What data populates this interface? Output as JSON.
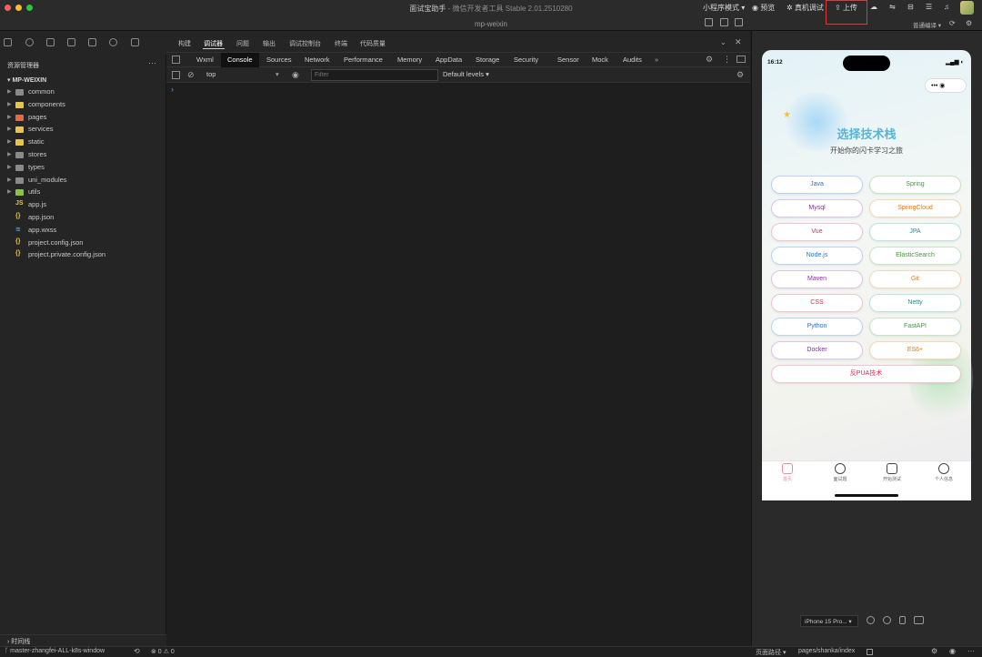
{
  "window": {
    "title": "面试宝助手",
    "title_suffix": " - 微信开发者工具 Stable 2.01.2510280",
    "project": "mp-weixin"
  },
  "toolbar": {
    "mode": "小程序模式 ▾",
    "preview": "预览",
    "real_debug": "真机调试",
    "upload": "上传",
    "compile_mode": "普通编译 ▾"
  },
  "sidebar": {
    "header": "资源管理器",
    "more": "···",
    "project_name": "MP-WEIXIN",
    "folders": [
      {
        "name": "common",
        "color": "#8a8a8a"
      },
      {
        "name": "components",
        "color": "#e8c44a"
      },
      {
        "name": "pages",
        "color": "#e06a4a"
      },
      {
        "name": "services",
        "color": "#e8c44a"
      },
      {
        "name": "static",
        "color": "#e8c44a"
      },
      {
        "name": "stores",
        "color": "#8a8a8a"
      },
      {
        "name": "types",
        "color": "#8a8a8a"
      },
      {
        "name": "uni_modules",
        "color": "#8a8a8a"
      },
      {
        "name": "utils",
        "color": "#8bc34a"
      }
    ],
    "files": [
      {
        "name": "app.js",
        "icon": "JS",
        "color": "#e8c44a"
      },
      {
        "name": "app.json",
        "icon": "{}",
        "color": "#e8c44a"
      },
      {
        "name": "app.wxss",
        "icon": "≋",
        "color": "#4a9de6"
      },
      {
        "name": "project.config.json",
        "icon": "{}",
        "color": "#e8c44a"
      },
      {
        "name": "project.private.config.json",
        "icon": "{}",
        "color": "#e8c44a"
      }
    ],
    "timeline": "时间线"
  },
  "devtools": {
    "top_tabs": [
      "构建",
      "调试器",
      "问题",
      "输出",
      "调试控制台",
      "终端",
      "代码质量"
    ],
    "chrome_tabs": [
      "Wxml",
      "Console",
      "Sources",
      "Network",
      "Performance",
      "Memory",
      "AppData",
      "Storage",
      "Security",
      "Sensor",
      "Mock",
      "Audits"
    ],
    "overflow": "»",
    "context": "top",
    "filter_placeholder": "Filter",
    "levels": "Default levels ▾",
    "prompt": "›"
  },
  "simulator": {
    "time": "16:12",
    "status_right": "▂▄▆ ◐",
    "capsule": "•••  ◉",
    "title": "选择技术栈",
    "subtitle": "开始你的闪卡学习之旅",
    "tech_buttons": [
      {
        "label": "Java",
        "color": "#2d6fd1",
        "border": "#b9d3f5"
      },
      {
        "label": "Spring",
        "color": "#3e9a3e",
        "border": "#c5e6c3"
      },
      {
        "label": "Mysql",
        "color": "#8a2ba8",
        "border": "#dcc5ea"
      },
      {
        "label": "SpringCloud",
        "color": "#e0791d",
        "border": "#f4d8b9"
      },
      {
        "label": "Vue",
        "color": "#d6304f",
        "border": "#f3c4cf"
      },
      {
        "label": "JPA",
        "color": "#2a8a8a",
        "border": "#bfe3e1"
      },
      {
        "label": "Node.js",
        "color": "#2d6fd1",
        "border": "#b9d3f5"
      },
      {
        "label": "ElasticSearch",
        "color": "#3e9a3e",
        "border": "#c5e6c3"
      },
      {
        "label": "Maven",
        "color": "#8a2ba8",
        "border": "#dcc5ea"
      },
      {
        "label": "Git",
        "color": "#e0791d",
        "border": "#f4d8b9"
      },
      {
        "label": "CSS",
        "color": "#d6304f",
        "border": "#f3c4cf"
      },
      {
        "label": "Netty",
        "color": "#2a8a8a",
        "border": "#bfe3e1"
      },
      {
        "label": "Python",
        "color": "#2d6fd1",
        "border": "#b9d3f5"
      },
      {
        "label": "FastAPI",
        "color": "#3e9a3e",
        "border": "#c5e6c3"
      },
      {
        "label": "Docker",
        "color": "#8a2ba8",
        "border": "#dcc5ea"
      },
      {
        "label": "ES6+",
        "color": "#e0791d",
        "border": "#f4d8b9"
      },
      {
        "label": "反PUA技术",
        "color": "#d6304f",
        "border": "#f3c4cf"
      }
    ],
    "tabbar": [
      {
        "label": "首页",
        "color": "#f08aa0"
      },
      {
        "label": "面试题",
        "color": "#666"
      },
      {
        "label": "开始测试",
        "color": "#666"
      },
      {
        "label": "个人信息",
        "color": "#666"
      }
    ],
    "device": "iPhone 15 Pro... ▾"
  },
  "statusbar": {
    "branch": "master-zhangfei-ALL-k8s-window",
    "sync": "⟲",
    "problems": "⊗ 0 ⚠ 0",
    "page_path_label": "页面路径 ▾",
    "page_path": "pages/shanka/index"
  }
}
